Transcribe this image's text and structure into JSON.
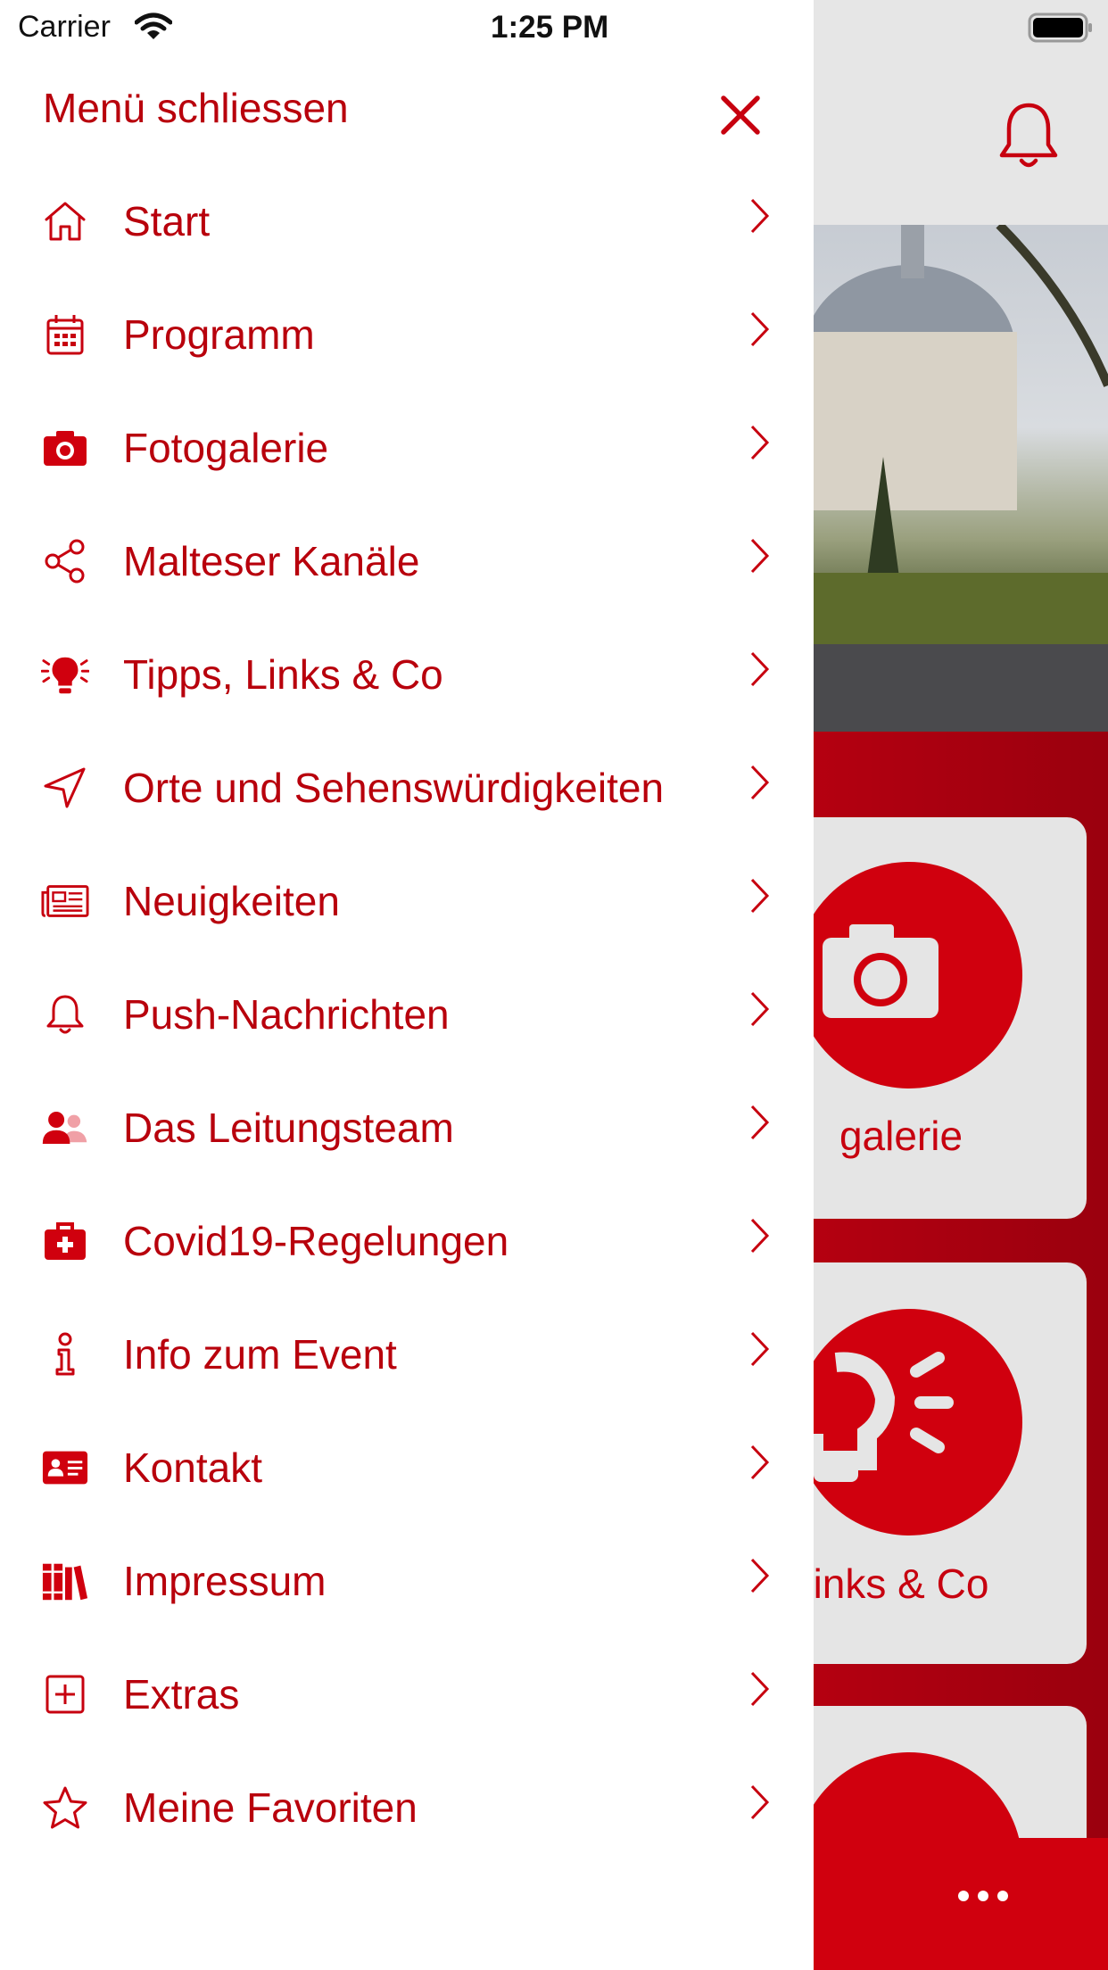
{
  "status_bar": {
    "carrier": "Carrier",
    "time": "1:25 PM"
  },
  "drawer": {
    "close_label": "Menü schliessen",
    "items": [
      {
        "label": "Start",
        "icon": "home-icon"
      },
      {
        "label": "Programm",
        "icon": "calendar-icon"
      },
      {
        "label": "Fotogalerie",
        "icon": "camera-icon"
      },
      {
        "label": "Malteser Kanäle",
        "icon": "share-icon"
      },
      {
        "label": "Tipps, Links & Co",
        "icon": "lightbulb-icon"
      },
      {
        "label": "Orte und Sehenswürdigkeiten",
        "icon": "location-arrow-icon"
      },
      {
        "label": "Neuigkeiten",
        "icon": "newspaper-icon"
      },
      {
        "label": "Push-Nachrichten",
        "icon": "bell-icon"
      },
      {
        "label": "Das Leitungsteam",
        "icon": "users-icon"
      },
      {
        "label": "Covid19-Regelungen",
        "icon": "medical-kit-icon"
      },
      {
        "label": "Info zum Event",
        "icon": "info-icon"
      },
      {
        "label": "Kontakt",
        "icon": "contact-card-icon"
      },
      {
        "label": "Impressum",
        "icon": "books-icon"
      },
      {
        "label": "Extras",
        "icon": "plus-square-icon"
      },
      {
        "label": "Meine Favoriten",
        "icon": "star-icon"
      }
    ]
  },
  "background": {
    "tiles": [
      {
        "label": "galerie",
        "icon": "camera-icon"
      },
      {
        "label": "inks & Co",
        "icon": "lightbulb-icon"
      }
    ]
  },
  "colors": {
    "accent": "#c7000f",
    "text_red": "#b8000c",
    "drawer_bg": "#ffffff",
    "overlay_bg": "#e6e6e6"
  }
}
